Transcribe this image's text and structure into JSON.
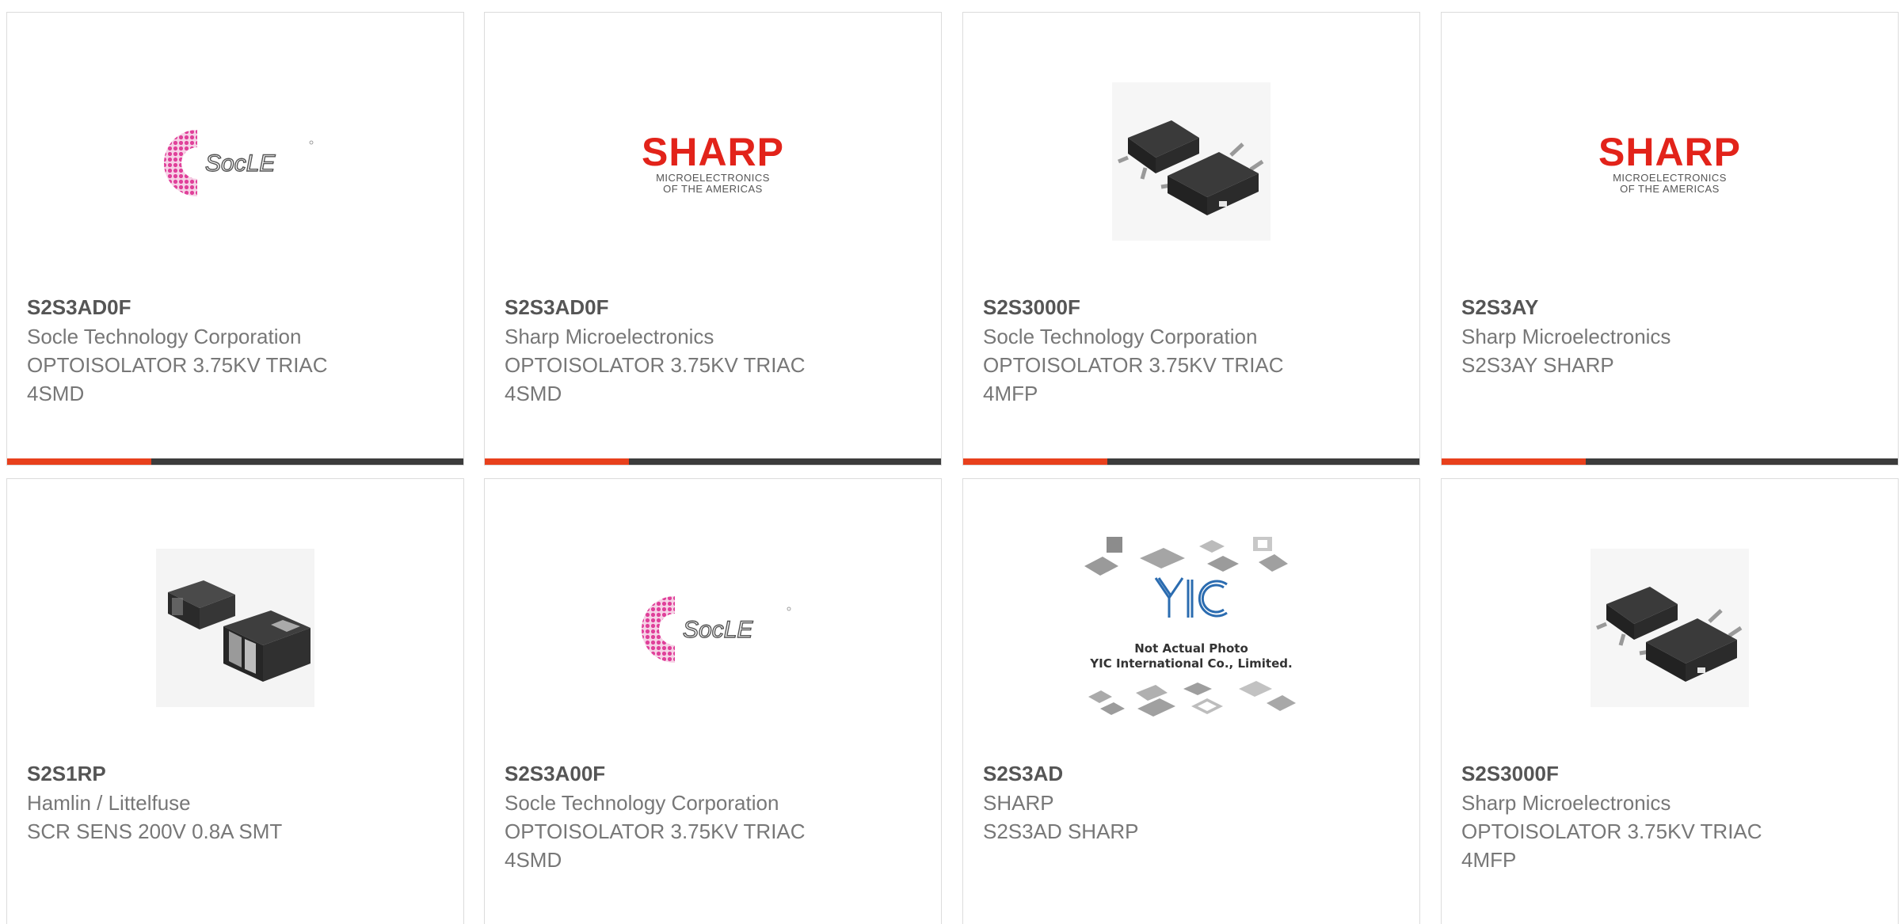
{
  "cards": [
    {
      "part_number": "S2S3AD0F",
      "manufacturer": "Socle Technology Corporation",
      "desc_line1": "OPTOISOLATOR 3.75KV TRIAC",
      "desc_line2": "4SMD",
      "image": "socle-logo"
    },
    {
      "part_number": "S2S3AD0F",
      "manufacturer": "Sharp Microelectronics",
      "desc_line1": "OPTOISOLATOR 3.75KV TRIAC",
      "desc_line2": "4SMD",
      "image": "sharp-logo",
      "logo_word": "SHARP",
      "logo_sub1": "MICROELECTRONICS",
      "logo_sub2": "OF THE AMERICAS"
    },
    {
      "part_number": "S2S3000F",
      "manufacturer": "Socle Technology Corporation",
      "desc_line1": "OPTOISOLATOR 3.75KV TRIAC",
      "desc_line2": "4MFP",
      "image": "chip-photo"
    },
    {
      "part_number": "S2S3AY",
      "manufacturer": "Sharp Microelectronics",
      "desc_line1": "S2S3AY SHARP",
      "desc_line2": "",
      "image": "sharp-logo",
      "logo_word": "SHARP",
      "logo_sub1": "MICROELECTRONICS",
      "logo_sub2": "OF THE AMERICAS"
    },
    {
      "part_number": "S2S1RP",
      "manufacturer": "Hamlin / Littelfuse",
      "desc_line1": "SCR SENS 200V 0.8A SMT",
      "desc_line2": "",
      "image": "smd-diode-photo"
    },
    {
      "part_number": "S2S3A00F",
      "manufacturer": "Socle Technology Corporation",
      "desc_line1": "OPTOISOLATOR 3.75KV TRIAC",
      "desc_line2": "4SMD",
      "image": "socle-logo"
    },
    {
      "part_number": "S2S3AD",
      "manufacturer": "SHARP",
      "desc_line1": "S2S3AD SHARP",
      "desc_line2": "",
      "image": "yic-placeholder",
      "caption_line1": "Not Actual Photo",
      "caption_line2": "YIC International Co., Limited."
    },
    {
      "part_number": "S2S3000F",
      "manufacturer": "Sharp Microelectronics",
      "desc_line1": "OPTOISOLATOR 3.75KV TRIAC",
      "desc_line2": "4MFP",
      "image": "chip-photo"
    }
  ],
  "colors": {
    "accent": "#e8401c",
    "bar": "#3c3c3c",
    "sharp_red": "#e2231a",
    "socle_pink": "#e0409a"
  }
}
